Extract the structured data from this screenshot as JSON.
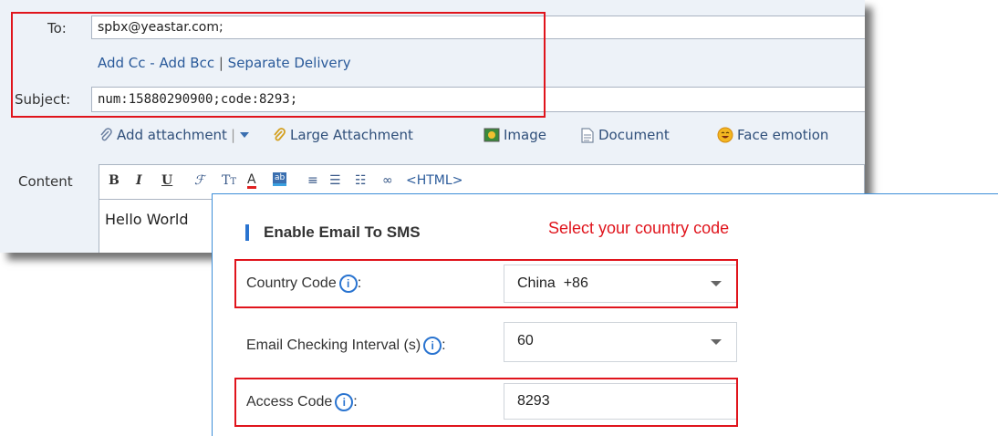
{
  "compose": {
    "to_label": "To:",
    "to_value": "spbx@yeastar.com;",
    "add_cc": "Add Cc",
    "sep1": " - ",
    "add_bcc": "Add Bcc",
    "sep2": " | ",
    "separate_delivery": "Separate Delivery",
    "subject_label": "Subject:",
    "subject_value": "num:15880290900;code:8293;",
    "attach": {
      "add_attachment": "Add attachment",
      "large_attachment": "Large Attachment",
      "image": "Image",
      "document": "Document",
      "face_emotion": "Face emotion"
    },
    "content_label": "Content",
    "html_toggle": "<HTML>",
    "body_text": "Hello World"
  },
  "sms": {
    "title": "Enable Email To SMS",
    "annotation": "Select your country code",
    "annotation_color": "#e0141c",
    "country_code_label": "Country Code",
    "country_code_value": "China  +86",
    "interval_label": "Email Checking Interval (s)",
    "interval_value": "60",
    "access_code_label": "Access Code",
    "access_code_value": "8293",
    "info_glyph": "i",
    "colon": ":"
  }
}
